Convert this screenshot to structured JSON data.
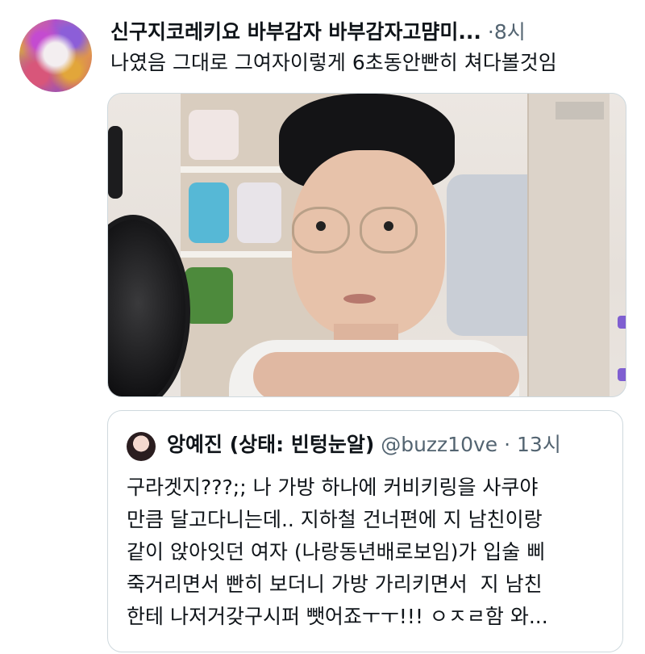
{
  "tweet": {
    "display_name": "신구지코레키요 바부감자 바부감자고먐미...",
    "time": "8시",
    "text": "나였음 그대로 그여자이렇게 6초동안빤히 쳐다볼것임",
    "media_desc": "video-thumbnail"
  },
  "quoted_tweet": {
    "display_name": "앙예진 (상태: 빈텅눈알)",
    "handle": "@buzz10ve",
    "time": "13시",
    "text": "구라겟지???;; 나 가방 하나에 커비키링을 사쿠야\n만큼 달고다니는데.. 지하철 건너편에 지 남친이랑\n같이 앉아잇던 여자 (나랑동년배로보임)가 입술 삐\n죽거리면서 빤히 보더니 가방 가리키면서  지 남친\n한테 나저거갖구시퍼 뺏어죠ㅜㅜ!!! ㅇㅈㄹ함 와..."
  },
  "colors": {
    "text_primary": "#0f1419",
    "text_secondary": "#536471",
    "border": "#cfd9de"
  },
  "icons": [
    "profile-avatar",
    "quoted-avatar"
  ]
}
